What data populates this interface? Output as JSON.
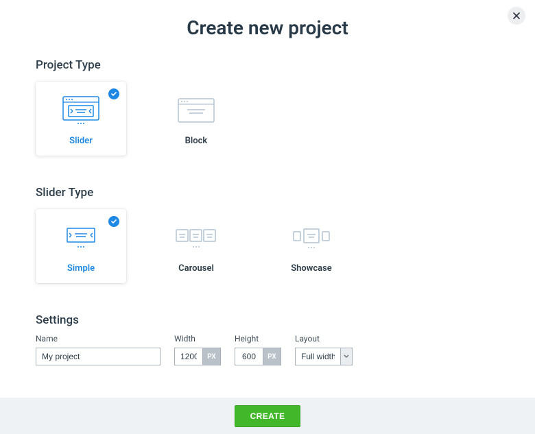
{
  "title": "Create new project",
  "close_icon": "close",
  "sections": {
    "project_type": {
      "heading": "Project Type",
      "options": [
        {
          "id": "slider-option",
          "label": "Slider",
          "selected": true
        },
        {
          "id": "block-option",
          "label": "Block",
          "selected": false
        }
      ]
    },
    "slider_type": {
      "heading": "Slider Type",
      "options": [
        {
          "id": "simple-option",
          "label": "Simple",
          "selected": true
        },
        {
          "id": "carousel-option",
          "label": "Carousel",
          "selected": false
        },
        {
          "id": "showcase-option",
          "label": "Showcase",
          "selected": false
        }
      ]
    },
    "settings": {
      "heading": "Settings",
      "name": {
        "label": "Name",
        "value": "My project"
      },
      "width": {
        "label": "Width",
        "value": "1200",
        "unit": "PX"
      },
      "height": {
        "label": "Height",
        "value": "600",
        "unit": "PX"
      },
      "layout": {
        "label": "Layout",
        "value": "Full width"
      }
    }
  },
  "footer": {
    "create_label": "CREATE"
  }
}
